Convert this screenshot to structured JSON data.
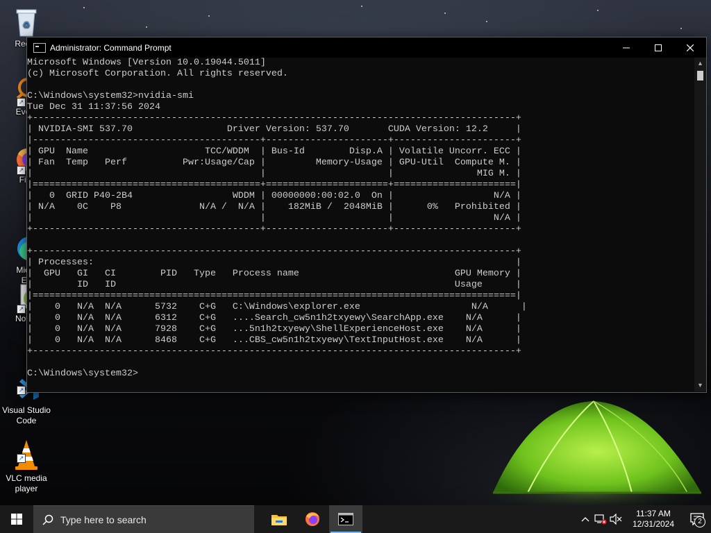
{
  "desktop": {
    "icons": [
      {
        "label": "Recyc",
        "icon": "recycle-bin-icon"
      },
      {
        "label": "Every",
        "icon": "everything-search-icon"
      },
      {
        "label": "Fire",
        "icon": "firefox-icon"
      },
      {
        "label": "Micro\nEd",
        "icon": "microsoft-edge-icon"
      },
      {
        "label": "Notep",
        "icon": "notepad-plus-plus-icon"
      },
      {
        "label": "Visual Studio\nCode",
        "icon": "vscode-icon"
      },
      {
        "label": "VLC media\nplayer",
        "icon": "vlc-icon"
      }
    ]
  },
  "window": {
    "title": "Administrator: Command Prompt",
    "controls": {
      "minimize": "minimize-icon",
      "maximize": "maximize-icon",
      "close": "close-icon"
    }
  },
  "console": {
    "lines": [
      "Microsoft Windows [Version 10.0.19044.5011]",
      "(c) Microsoft Corporation. All rights reserved.",
      "",
      "C:\\Windows\\system32>nvidia-smi",
      "Tue Dec 31 11:37:56 2024",
      "+---------------------------------------------------------------------------------------+",
      "| NVIDIA-SMI 537.70                 Driver Version: 537.70       CUDA Version: 12.2     |",
      "|-----------------------------------------+----------------------+----------------------+",
      "| GPU  Name                     TCC/WDDM  | Bus-Id        Disp.A | Volatile Uncorr. ECC |",
      "| Fan  Temp   Perf          Pwr:Usage/Cap |         Memory-Usage | GPU-Util  Compute M. |",
      "|                                         |                      |               MIG M. |",
      "|=========================================+======================+======================|",
      "|   0  GRID P40-2B4                  WDDM | 00000000:00:02.0  On |                  N/A |",
      "| N/A    0C    P8              N/A /  N/A |    182MiB /  2048MiB |      0%   Prohibited |",
      "|                                         |                      |                  N/A |",
      "+-----------------------------------------+----------------------+----------------------+",
      "",
      "+---------------------------------------------------------------------------------------+",
      "| Processes:                                                                            |",
      "|  GPU   GI   CI        PID   Type   Process name                            GPU Memory |",
      "|        ID   ID                                                             Usage      |",
      "|=======================================================================================|",
      "|    0   N/A  N/A      5732    C+G   C:\\Windows\\explorer.exe                    N/A      |",
      "|    0   N/A  N/A      6312    C+G   ....Search_cw5n1h2txyewy\\SearchApp.exe    N/A      |",
      "|    0   N/A  N/A      7928    C+G   ...5n1h2txyewy\\ShellExperienceHost.exe    N/A      |",
      "|    0   N/A  N/A      8468    C+G   ...CBS_cw5n1h2txyewy\\TextInputHost.exe    N/A      |",
      "+---------------------------------------------------------------------------------------+",
      "",
      "C:\\Windows\\system32>"
    ]
  },
  "taskbar": {
    "search_placeholder": "Type here to search",
    "apps": [
      {
        "name": "file-explorer-icon",
        "active": false
      },
      {
        "name": "firefox-icon",
        "active": false
      },
      {
        "name": "command-prompt-icon",
        "active": true
      }
    ],
    "tray": {
      "time": "11:37 AM",
      "date": "12/31/2024",
      "notification_count": "2"
    }
  },
  "colors": {
    "console_bg": "#0c0c0c",
    "console_fg": "#cccccc",
    "taskbar_bg": "#1a1a1a",
    "search_bg": "#3a3a3a",
    "active_indicator": "#76b9ed",
    "tent_green": "#7fd52a"
  }
}
